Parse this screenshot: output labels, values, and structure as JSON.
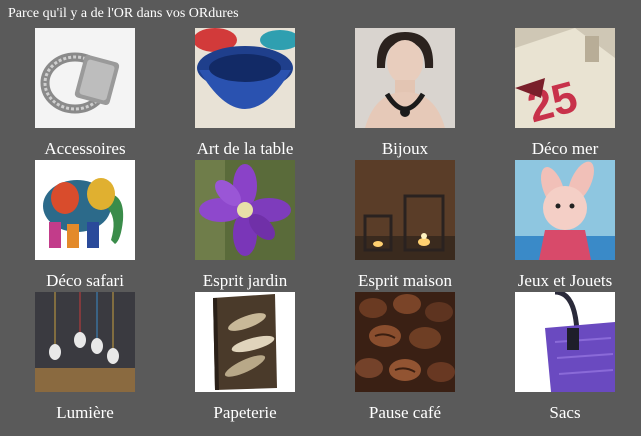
{
  "header": {
    "tagline": "Parce qu'il y a de l'OR dans vos ORdures"
  },
  "categories": [
    {
      "label": "Accessoires",
      "icon": "ring-photo"
    },
    {
      "label": "Art de la table",
      "icon": "bowl-photo"
    },
    {
      "label": "Bijoux",
      "icon": "necklace-model-photo"
    },
    {
      "label": "Déco mer",
      "icon": "sailcloth-photo"
    },
    {
      "label": "Déco safari",
      "icon": "elephant-photo"
    },
    {
      "label": "Esprit jardin",
      "icon": "clematis-flower-photo"
    },
    {
      "label": "Esprit maison",
      "icon": "lanterns-photo"
    },
    {
      "label": "Jeux et Jouets",
      "icon": "plush-toy-photo"
    },
    {
      "label": "Lumière",
      "icon": "bulbs-photo"
    },
    {
      "label": "Papeterie",
      "icon": "notebook-photo"
    },
    {
      "label": "Pause café",
      "icon": "coffee-beans-photo"
    },
    {
      "label": "Sacs",
      "icon": "purple-bag-photo"
    }
  ]
}
